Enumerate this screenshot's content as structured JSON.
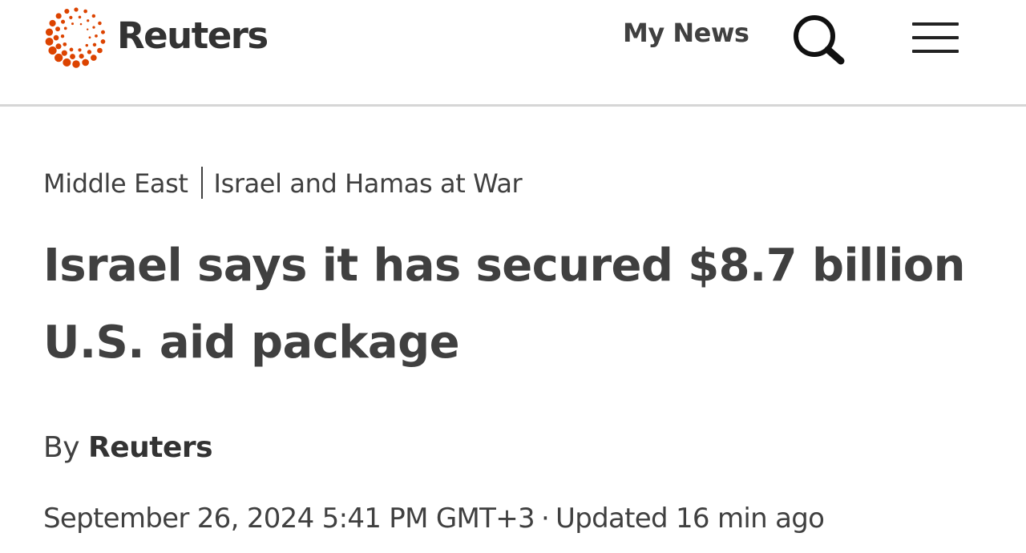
{
  "header": {
    "brand": "Reuters",
    "my_news_label": "My News",
    "brand_color": "#dc4300",
    "search_icon": "search-icon",
    "menu_icon": "hamburger-menu-icon"
  },
  "article": {
    "breadcrumb": [
      "Middle East",
      "Israel and Hamas at War"
    ],
    "headline": "Israel says it has secured $8.7 billion U.S. aid package",
    "byline_prefix": "By",
    "author": "Reuters",
    "published": "September 26, 2024 5:41 PM GMT+3",
    "separator": "·",
    "updated": "Updated 16 min ago"
  }
}
